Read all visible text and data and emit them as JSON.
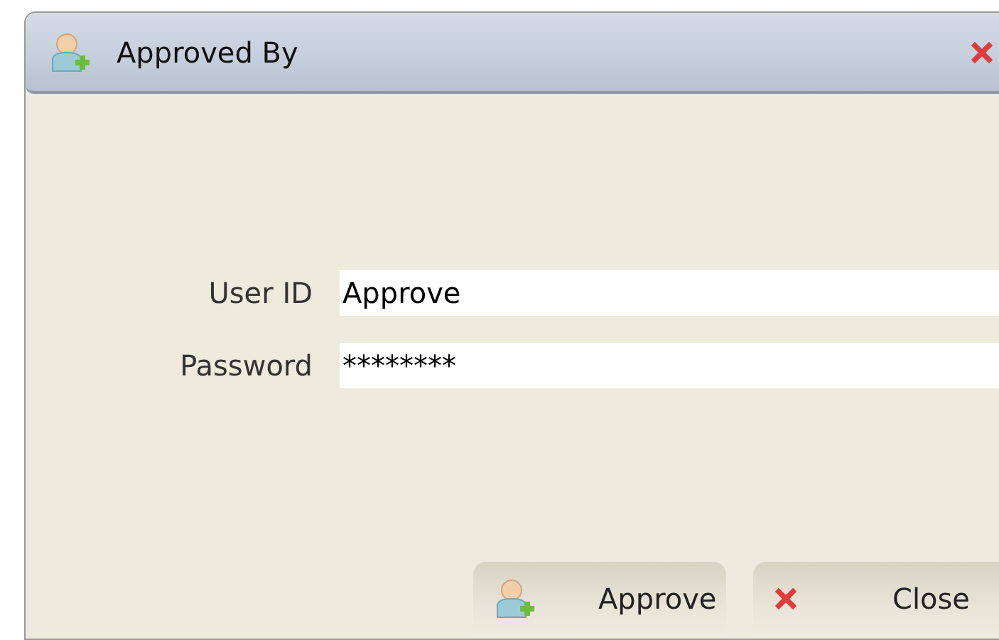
{
  "window": {
    "title": "Approved By"
  },
  "fields": [
    {
      "label": "User ID",
      "value": "Approve"
    },
    {
      "label": "Password",
      "value": "********"
    }
  ],
  "buttons": [
    {
      "label": "Approve",
      "kind": "approve"
    },
    {
      "label": "Close",
      "kind": "close"
    }
  ]
}
